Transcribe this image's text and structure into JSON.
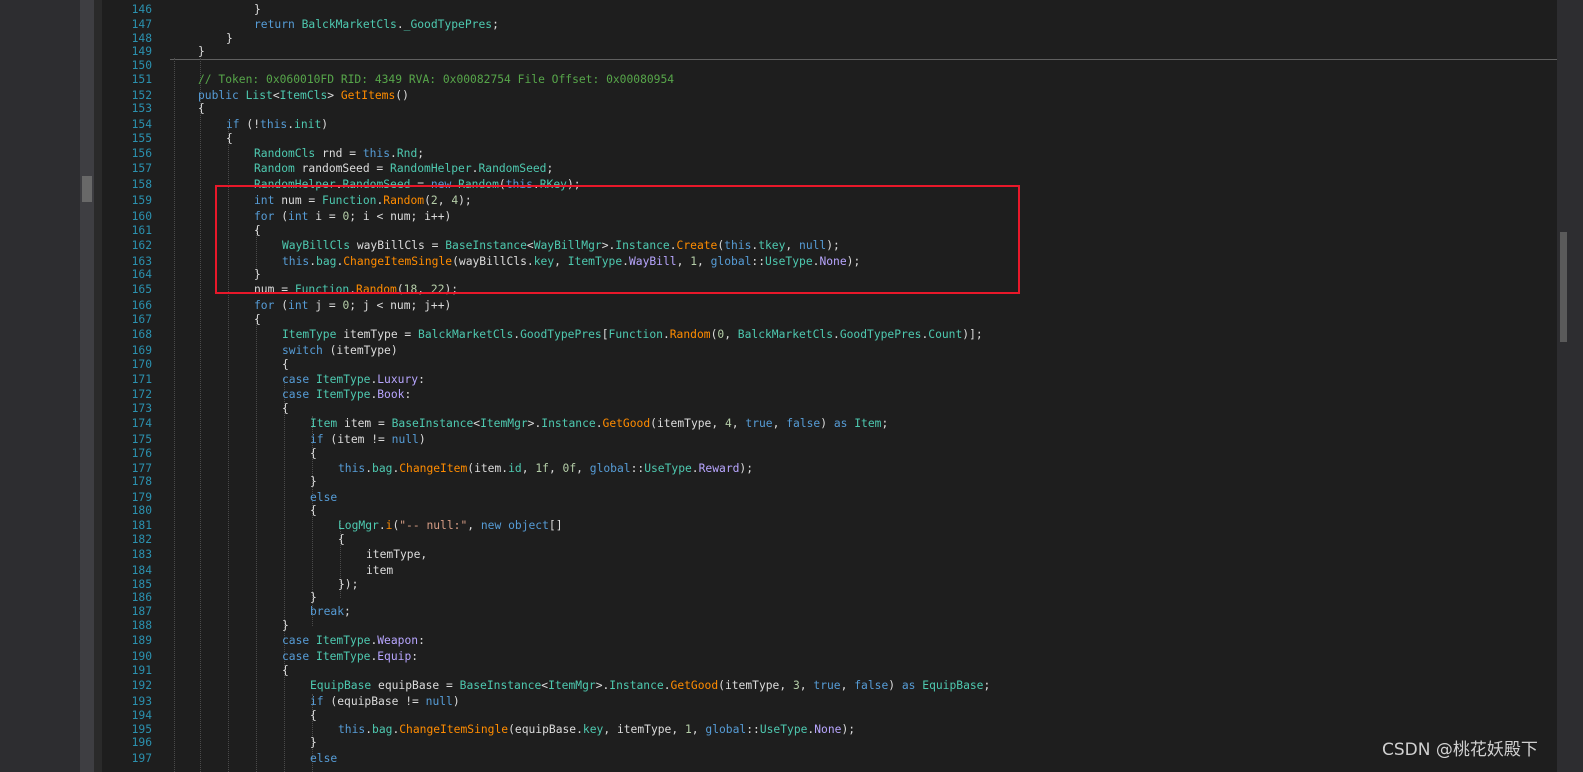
{
  "watermark": "CSDN @桃花妖殿下",
  "lines": [
    {
      "n": "146",
      "t": [
        [
          "pu",
          "}"
        ]
      ]
    },
    {
      "n": "147",
      "t": [
        [
          "kw",
          "return "
        ],
        [
          "ty",
          "BalckMarketCls"
        ],
        [
          "pu",
          "."
        ],
        [
          "pr",
          "_GoodTypePres"
        ],
        [
          "pu",
          ";"
        ]
      ]
    },
    {
      "n": "148",
      "t": [
        [
          "pu",
          "}"
        ]
      ]
    },
    {
      "n": "149",
      "t": [
        [
          "pu",
          "}"
        ]
      ]
    },
    {
      "n": "150",
      "t": []
    },
    {
      "n": "151",
      "t": [
        [
          "cm",
          "// Token: 0x060010FD RID: 4349 RVA: 0x00082754 File Offset: 0x00080954"
        ]
      ]
    },
    {
      "n": "152",
      "t": [
        [
          "kw",
          "public "
        ],
        [
          "ty",
          "List"
        ],
        [
          "pu",
          "<"
        ],
        [
          "ty",
          "ItemCls"
        ],
        [
          "pu",
          "> "
        ],
        [
          "mt",
          "GetItems"
        ],
        [
          "pu",
          "()"
        ]
      ]
    },
    {
      "n": "153",
      "t": [
        [
          "pu",
          "{"
        ]
      ]
    },
    {
      "n": "154",
      "t": [
        [
          "kw",
          "if "
        ],
        [
          "pu",
          "(!"
        ],
        [
          "kw",
          "this"
        ],
        [
          "pu",
          "."
        ],
        [
          "pr",
          "init"
        ],
        [
          "pu",
          ")"
        ]
      ]
    },
    {
      "n": "155",
      "t": [
        [
          "pu",
          "{"
        ]
      ]
    },
    {
      "n": "156",
      "t": [
        [
          "ty",
          "RandomCls "
        ],
        [
          "id",
          "rnd = "
        ],
        [
          "kw",
          "this"
        ],
        [
          "pu",
          "."
        ],
        [
          "pr",
          "Rnd"
        ],
        [
          "pu",
          ";"
        ]
      ]
    },
    {
      "n": "157",
      "t": [
        [
          "ty",
          "Random "
        ],
        [
          "id",
          "randomSeed = "
        ],
        [
          "ty",
          "RandomHelper"
        ],
        [
          "pu",
          "."
        ],
        [
          "pr",
          "RandomSeed"
        ],
        [
          "pu",
          ";"
        ]
      ]
    },
    {
      "n": "158",
      "t": [
        [
          "ty",
          "RandomHelper"
        ],
        [
          "pu",
          "."
        ],
        [
          "pr",
          "RandomSeed"
        ],
        [
          "id",
          " = "
        ],
        [
          "kw",
          "new "
        ],
        [
          "ty",
          "Random"
        ],
        [
          "pu",
          "("
        ],
        [
          "kw",
          "this"
        ],
        [
          "pu",
          "."
        ],
        [
          "pr",
          "RKey"
        ],
        [
          "pu",
          ");"
        ]
      ]
    },
    {
      "n": "159",
      "t": [
        [
          "kw",
          "int "
        ],
        [
          "id",
          "num = "
        ],
        [
          "ty",
          "Function"
        ],
        [
          "pu",
          "."
        ],
        [
          "mt",
          "Random"
        ],
        [
          "pu",
          "("
        ],
        [
          "num",
          "2"
        ],
        [
          "pu",
          ", "
        ],
        [
          "num",
          "4"
        ],
        [
          "pu",
          ");"
        ]
      ]
    },
    {
      "n": "160",
      "t": [
        [
          "kw",
          "for "
        ],
        [
          "pu",
          "("
        ],
        [
          "kw",
          "int "
        ],
        [
          "id",
          "i = "
        ],
        [
          "num",
          "0"
        ],
        [
          "pu",
          "; "
        ],
        [
          "id",
          "i < num; i++"
        ],
        [
          "pu",
          ")"
        ]
      ]
    },
    {
      "n": "161",
      "t": [
        [
          "pu",
          "{"
        ]
      ]
    },
    {
      "n": "162",
      "t": [
        [
          "ty",
          "WayBillCls "
        ],
        [
          "id",
          "wayBillCls = "
        ],
        [
          "ty",
          "BaseInstance"
        ],
        [
          "pu",
          "<"
        ],
        [
          "ty",
          "WayBillMgr"
        ],
        [
          "pu",
          ">."
        ],
        [
          "pr",
          "Instance"
        ],
        [
          "pu",
          "."
        ],
        [
          "mt",
          "Create"
        ],
        [
          "pu",
          "("
        ],
        [
          "kw",
          "this"
        ],
        [
          "pu",
          "."
        ],
        [
          "pr",
          "tkey"
        ],
        [
          "pu",
          ", "
        ],
        [
          "kw",
          "null"
        ],
        [
          "pu",
          ");"
        ]
      ]
    },
    {
      "n": "163",
      "t": [
        [
          "kw",
          "this"
        ],
        [
          "pu",
          "."
        ],
        [
          "pr",
          "bag"
        ],
        [
          "pu",
          "."
        ],
        [
          "mt",
          "ChangeItemSingle"
        ],
        [
          "pu",
          "("
        ],
        [
          "id",
          "wayBillCls"
        ],
        [
          "pu",
          "."
        ],
        [
          "pr",
          "key"
        ],
        [
          "pu",
          ", "
        ],
        [
          "ty",
          "ItemType"
        ],
        [
          "pu",
          "."
        ],
        [
          "en",
          "WayBill"
        ],
        [
          "pu",
          ", "
        ],
        [
          "num",
          "1"
        ],
        [
          "pu",
          ", "
        ],
        [
          "kw",
          "global"
        ],
        [
          "pu",
          "::"
        ],
        [
          "ty",
          "UseType"
        ],
        [
          "pu",
          "."
        ],
        [
          "en",
          "None"
        ],
        [
          "pu",
          ");"
        ]
      ]
    },
    {
      "n": "164",
      "t": [
        [
          "pu",
          "}"
        ]
      ]
    },
    {
      "n": "165",
      "t": [
        [
          "id",
          "num = "
        ],
        [
          "ty",
          "Function"
        ],
        [
          "pu",
          "."
        ],
        [
          "mt",
          "Random"
        ],
        [
          "pu",
          "("
        ],
        [
          "num",
          "18"
        ],
        [
          "pu",
          ", "
        ],
        [
          "num",
          "22"
        ],
        [
          "pu",
          ");"
        ]
      ]
    },
    {
      "n": "166",
      "t": [
        [
          "kw",
          "for "
        ],
        [
          "pu",
          "("
        ],
        [
          "kw",
          "int "
        ],
        [
          "id",
          "j = "
        ],
        [
          "num",
          "0"
        ],
        [
          "pu",
          "; "
        ],
        [
          "id",
          "j < num; j++"
        ],
        [
          "pu",
          ")"
        ]
      ]
    },
    {
      "n": "167",
      "t": [
        [
          "pu",
          "{"
        ]
      ]
    },
    {
      "n": "168",
      "t": [
        [
          "ty",
          "ItemType "
        ],
        [
          "id",
          "itemType = "
        ],
        [
          "ty",
          "BalckMarketCls"
        ],
        [
          "pu",
          "."
        ],
        [
          "pr",
          "GoodTypePres"
        ],
        [
          "pu",
          "["
        ],
        [
          "ty",
          "Function"
        ],
        [
          "pu",
          "."
        ],
        [
          "mt",
          "Random"
        ],
        [
          "pu",
          "("
        ],
        [
          "num",
          "0"
        ],
        [
          "pu",
          ", "
        ],
        [
          "ty",
          "BalckMarketCls"
        ],
        [
          "pu",
          "."
        ],
        [
          "pr",
          "GoodTypePres"
        ],
        [
          "pu",
          "."
        ],
        [
          "pr",
          "Count"
        ],
        [
          "pu",
          ")];"
        ]
      ]
    },
    {
      "n": "169",
      "t": [
        [
          "kw",
          "switch "
        ],
        [
          "pu",
          "("
        ],
        [
          "id",
          "itemType"
        ],
        [
          "pu",
          ")"
        ]
      ]
    },
    {
      "n": "170",
      "t": [
        [
          "pu",
          "{"
        ]
      ]
    },
    {
      "n": "171",
      "t": [
        [
          "kw",
          "case "
        ],
        [
          "ty",
          "ItemType"
        ],
        [
          "pu",
          "."
        ],
        [
          "en",
          "Luxury"
        ],
        [
          "pu",
          ":"
        ]
      ]
    },
    {
      "n": "172",
      "t": [
        [
          "kw",
          "case "
        ],
        [
          "ty",
          "ItemType"
        ],
        [
          "pu",
          "."
        ],
        [
          "en",
          "Book"
        ],
        [
          "pu",
          ":"
        ]
      ]
    },
    {
      "n": "173",
      "t": [
        [
          "pu",
          "{"
        ]
      ]
    },
    {
      "n": "174",
      "t": [
        [
          "ty",
          "Item "
        ],
        [
          "id",
          "item = "
        ],
        [
          "ty",
          "BaseInstance"
        ],
        [
          "pu",
          "<"
        ],
        [
          "ty",
          "ItemMgr"
        ],
        [
          "pu",
          ">."
        ],
        [
          "pr",
          "Instance"
        ],
        [
          "pu",
          "."
        ],
        [
          "mt",
          "GetGood"
        ],
        [
          "pu",
          "("
        ],
        [
          "id",
          "itemType"
        ],
        [
          "pu",
          ", "
        ],
        [
          "num",
          "4"
        ],
        [
          "pu",
          ", "
        ],
        [
          "kw",
          "true"
        ],
        [
          "pu",
          ", "
        ],
        [
          "kw",
          "false"
        ],
        [
          "pu",
          ") "
        ],
        [
          "kw",
          "as "
        ],
        [
          "ty",
          "Item"
        ],
        [
          "pu",
          ";"
        ]
      ]
    },
    {
      "n": "175",
      "t": [
        [
          "kw",
          "if "
        ],
        [
          "pu",
          "("
        ],
        [
          "id",
          "item != "
        ],
        [
          "kw",
          "null"
        ],
        [
          "pu",
          ")"
        ]
      ]
    },
    {
      "n": "176",
      "t": [
        [
          "pu",
          "{"
        ]
      ]
    },
    {
      "n": "177",
      "t": [
        [
          "kw",
          "this"
        ],
        [
          "pu",
          "."
        ],
        [
          "pr",
          "bag"
        ],
        [
          "pu",
          "."
        ],
        [
          "mt",
          "ChangeItem"
        ],
        [
          "pu",
          "("
        ],
        [
          "id",
          "item"
        ],
        [
          "pu",
          "."
        ],
        [
          "pr",
          "id"
        ],
        [
          "pu",
          ", "
        ],
        [
          "num",
          "1f"
        ],
        [
          "pu",
          ", "
        ],
        [
          "num",
          "0f"
        ],
        [
          "pu",
          ", "
        ],
        [
          "kw",
          "global"
        ],
        [
          "pu",
          "::"
        ],
        [
          "ty",
          "UseType"
        ],
        [
          "pu",
          "."
        ],
        [
          "en",
          "Reward"
        ],
        [
          "pu",
          ");"
        ]
      ]
    },
    {
      "n": "178",
      "t": [
        [
          "pu",
          "}"
        ]
      ]
    },
    {
      "n": "179",
      "t": [
        [
          "kw",
          "else"
        ]
      ]
    },
    {
      "n": "180",
      "t": [
        [
          "pu",
          "{"
        ]
      ]
    },
    {
      "n": "181",
      "t": [
        [
          "ty",
          "LogMgr"
        ],
        [
          "pu",
          "."
        ],
        [
          "mt",
          "i"
        ],
        [
          "pu",
          "("
        ],
        [
          "st",
          "\"-- null:\""
        ],
        [
          "pu",
          ", "
        ],
        [
          "kw",
          "new "
        ],
        [
          "kw",
          "object"
        ],
        [
          "pu",
          "[]"
        ]
      ]
    },
    {
      "n": "182",
      "t": [
        [
          "pu",
          "{"
        ]
      ]
    },
    {
      "n": "183",
      "t": [
        [
          "id",
          "itemType"
        ],
        [
          "pu",
          ","
        ]
      ]
    },
    {
      "n": "184",
      "t": [
        [
          "id",
          "item"
        ]
      ]
    },
    {
      "n": "185",
      "t": [
        [
          "pu",
          "});"
        ]
      ]
    },
    {
      "n": "186",
      "t": [
        [
          "pu",
          "}"
        ]
      ]
    },
    {
      "n": "187",
      "t": [
        [
          "kw",
          "break"
        ],
        [
          "pu",
          ";"
        ]
      ]
    },
    {
      "n": "188",
      "t": [
        [
          "pu",
          "}"
        ]
      ]
    },
    {
      "n": "189",
      "t": [
        [
          "kw",
          "case "
        ],
        [
          "ty",
          "ItemType"
        ],
        [
          "pu",
          "."
        ],
        [
          "en",
          "Weapon"
        ],
        [
          "pu",
          ":"
        ]
      ]
    },
    {
      "n": "190",
      "t": [
        [
          "kw",
          "case "
        ],
        [
          "ty",
          "ItemType"
        ],
        [
          "pu",
          "."
        ],
        [
          "en",
          "Equip"
        ],
        [
          "pu",
          ":"
        ]
      ]
    },
    {
      "n": "191",
      "t": [
        [
          "pu",
          "{"
        ]
      ]
    },
    {
      "n": "192",
      "t": [
        [
          "ty",
          "EquipBase "
        ],
        [
          "id",
          "equipBase = "
        ],
        [
          "ty",
          "BaseInstance"
        ],
        [
          "pu",
          "<"
        ],
        [
          "ty",
          "ItemMgr"
        ],
        [
          "pu",
          ">."
        ],
        [
          "pr",
          "Instance"
        ],
        [
          "pu",
          "."
        ],
        [
          "mt",
          "GetGood"
        ],
        [
          "pu",
          "("
        ],
        [
          "id",
          "itemType"
        ],
        [
          "pu",
          ", "
        ],
        [
          "num",
          "3"
        ],
        [
          "pu",
          ", "
        ],
        [
          "kw",
          "true"
        ],
        [
          "pu",
          ", "
        ],
        [
          "kw",
          "false"
        ],
        [
          "pu",
          ") "
        ],
        [
          "kw",
          "as "
        ],
        [
          "ty",
          "EquipBase"
        ],
        [
          "pu",
          ";"
        ]
      ]
    },
    {
      "n": "193",
      "t": [
        [
          "kw",
          "if "
        ],
        [
          "pu",
          "("
        ],
        [
          "id",
          "equipBase != "
        ],
        [
          "kw",
          "null"
        ],
        [
          "pu",
          ")"
        ]
      ]
    },
    {
      "n": "194",
      "t": [
        [
          "pu",
          "{"
        ]
      ]
    },
    {
      "n": "195",
      "t": [
        [
          "kw",
          "this"
        ],
        [
          "pu",
          "."
        ],
        [
          "pr",
          "bag"
        ],
        [
          "pu",
          "."
        ],
        [
          "mt",
          "ChangeItemSingle"
        ],
        [
          "pu",
          "("
        ],
        [
          "id",
          "equipBase"
        ],
        [
          "pu",
          "."
        ],
        [
          "pr",
          "key"
        ],
        [
          "pu",
          ", "
        ],
        [
          "id",
          "itemType"
        ],
        [
          "pu",
          ", "
        ],
        [
          "num",
          "1"
        ],
        [
          "pu",
          ", "
        ],
        [
          "kw",
          "global"
        ],
        [
          "pu",
          "::"
        ],
        [
          "ty",
          "UseType"
        ],
        [
          "pu",
          "."
        ],
        [
          "en",
          "None"
        ],
        [
          "pu",
          ");"
        ]
      ]
    },
    {
      "n": "196",
      "t": [
        [
          "pu",
          "}"
        ]
      ]
    },
    {
      "n": "197",
      "t": [
        [
          "kw",
          "else"
        ]
      ]
    }
  ]
}
